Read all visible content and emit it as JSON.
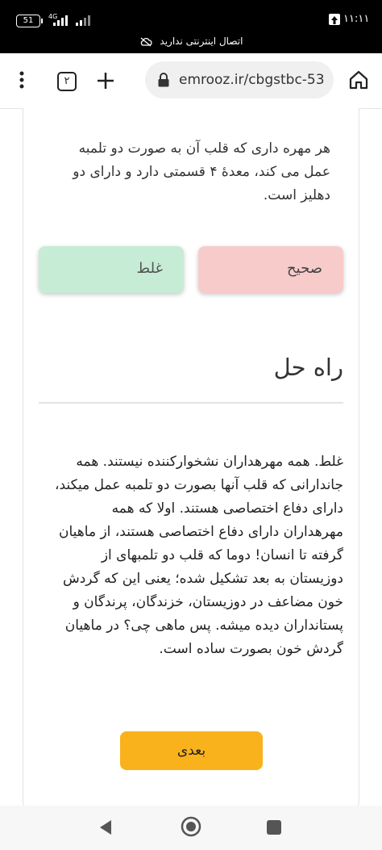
{
  "status_bar": {
    "battery_level": "51",
    "network_type": "4G",
    "time": "۱۱:۱۱",
    "offline_message": "اتصال اینترنتی ندارید"
  },
  "browser": {
    "tab_count": "۲",
    "url": "emrooz.ir/cbgstbc-53"
  },
  "quiz": {
    "question": "هر مهره داری که قلب آن به صورت دو تلمبه عمل می کند، معدۀ ۴ قسمتی دارد و دارای دو دهلیز است.",
    "correct_label": "صحیح",
    "wrong_label": "غلط",
    "solution_heading": "راه حل",
    "solution_text": "غلط. همه مهرهداران نشخوارکننده نیستند. همه جاندارانی که قلب آنها بصورت دو تلمبه عمل میکند، دارای دفاع اختصاصی هستند. اولا که همه مهرهداران دارای دفاع اختصاصی هستند، از ماهیان گرفته تا انسان! دوما که قلب دو تلمبهای از دوزیستان به بعد تشکیل شده؛ یعنی این که گردش خون مضاعف در دوزیستان، خزندگان، پرندگان و پستانداران دیده میشه. پس ماهی چی؟ در ماهیان گردش خون بصورت ساده است.",
    "next_label": "بعدی"
  },
  "colors": {
    "correct_bg": "#f8cbcb",
    "wrong_bg": "#c7ecd5",
    "next_bg": "#f9b21c"
  }
}
